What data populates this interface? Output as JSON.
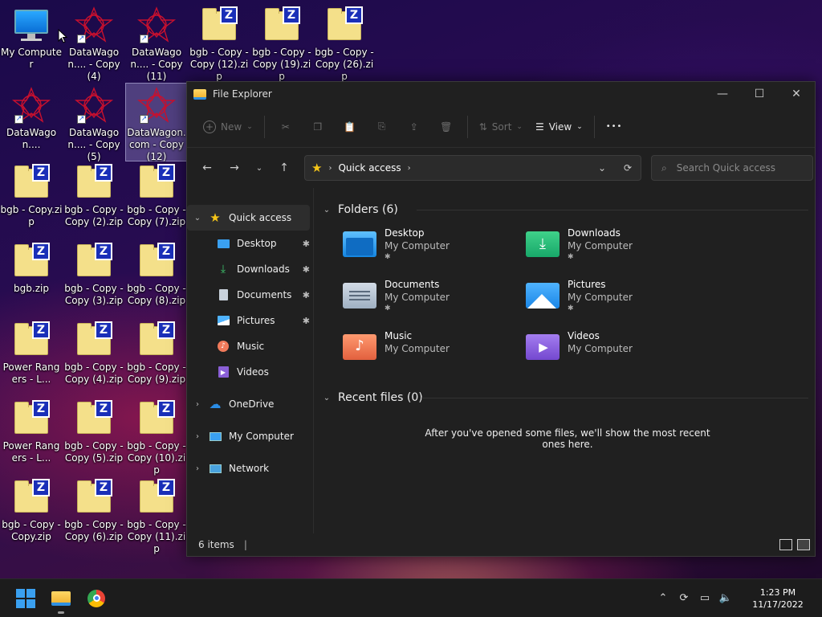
{
  "desktop": {
    "icons": [
      {
        "label": "My Computer"
      },
      {
        "label": "DataWagon.... - Copy (4)"
      },
      {
        "label": "DataWagon.... - Copy (11)"
      },
      {
        "label": "bgb - Copy - Copy (12).zip"
      },
      {
        "label": "bgb - Copy - Copy (19).zip"
      },
      {
        "label": "bgb - Copy - Copy (26).zip"
      },
      {
        "label": "DataWagon...."
      },
      {
        "label": "DataWagon.... - Copy (5)"
      },
      {
        "label": "DataWagon.com - Copy (12)"
      },
      {
        "label": "bgb - Copy.zip"
      },
      {
        "label": "bgb - Copy - Copy (2).zip"
      },
      {
        "label": "bgb - Copy - Copy (7).zip"
      },
      {
        "label": "bgb.zip"
      },
      {
        "label": "bgb - Copy - Copy (3).zip"
      },
      {
        "label": "bgb - Copy - Copy (8).zip"
      },
      {
        "label": "Power Rangers - L..."
      },
      {
        "label": "bgb - Copy - Copy (4).zip"
      },
      {
        "label": "bgb - Copy - Copy (9).zip"
      },
      {
        "label": "Power Rangers - L..."
      },
      {
        "label": "bgb - Copy - Copy (5).zip"
      },
      {
        "label": "bgb - Copy - Copy (10).zip"
      },
      {
        "label": "bgb - Copy - Copy.zip"
      },
      {
        "label": "bgb - Copy - Copy (6).zip"
      },
      {
        "label": "bgb - Copy - Copy (11).zip"
      }
    ]
  },
  "window": {
    "title": "File Explorer",
    "controls": {
      "minimize": "—",
      "maximize": "☐",
      "close": "✕"
    }
  },
  "toolbar": {
    "new_label": "New",
    "sort_label": "Sort",
    "view_label": "View",
    "more": "•••"
  },
  "address": {
    "location": "Quick access"
  },
  "search": {
    "placeholder": "Search Quick access"
  },
  "navpane": {
    "quick_access": "Quick access",
    "items": [
      {
        "label": "Desktop"
      },
      {
        "label": "Downloads"
      },
      {
        "label": "Documents"
      },
      {
        "label": "Pictures"
      },
      {
        "label": "Music"
      },
      {
        "label": "Videos"
      }
    ],
    "onedrive": "OneDrive",
    "my_computer": "My Computer",
    "network": "Network"
  },
  "content": {
    "folders_heading": "Folders (6)",
    "folders": [
      {
        "name": "Desktop",
        "location": "My Computer"
      },
      {
        "name": "Downloads",
        "location": "My Computer"
      },
      {
        "name": "Documents",
        "location": "My Computer"
      },
      {
        "name": "Pictures",
        "location": "My Computer"
      },
      {
        "name": "Music",
        "location": "My Computer"
      },
      {
        "name": "Videos",
        "location": "My Computer"
      }
    ],
    "recent_heading": "Recent files (0)",
    "recent_empty": "After you've opened some files, we'll show the most recent ones here."
  },
  "status": {
    "items": "6 items"
  },
  "clock": {
    "time": "1:23 PM",
    "date": "11/17/2022"
  },
  "colors": {
    "accent": "#0078d4",
    "window_bg": "#202020",
    "taskbar_bg": "#1c1c1c"
  }
}
